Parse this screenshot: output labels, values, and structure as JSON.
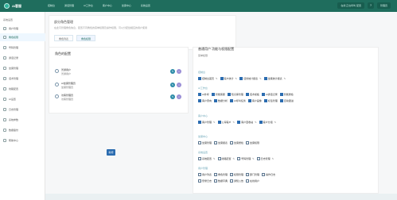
{
  "topbar": {
    "app_name": "AI客服",
    "nav": [
      "控制台",
      "通话管理",
      "AI工作台",
      "客户中心",
      "坐席中心",
      "系统设置"
    ],
    "status_pill": "在线 正在呼叫 配置",
    "help": "?",
    "user": "管理员"
  },
  "sidebar": {
    "title": "系统设置",
    "items": [
      "用户管理",
      "角色权限",
      "号码管理",
      "通话记录",
      "坐席管理",
      "话术管理",
      "线路配置",
      "AI设置",
      "日志管理",
      "系统参数",
      "数据备份",
      "帮助中心"
    ]
  },
  "header": {
    "title": "部分角色管理",
    "description": "在此可管理角色信息，配置不同角色的菜单权限及操作权限，可以分配给相应的用户使用",
    "tabs": [
      "角色列表",
      "角色权限"
    ]
  },
  "role_card": {
    "title": "角色的配置",
    "roles": [
      {
        "name": "普通用户",
        "desc": "普通用户"
      },
      {
        "name": "AI坐席管理员",
        "desc": "坐席管理员"
      },
      {
        "name": "访客管理员",
        "desc": "访客管理员"
      }
    ],
    "add_label": "新增"
  },
  "permissions": {
    "title": "普通用户 功能与权限配置",
    "subtitle": "菜单权限",
    "groups": [
      {
        "title": "控制台",
        "items": [
          {
            "t": "控制台首页",
            "c": true
          },
          {
            "t": "客户统计",
            "c": true
          },
          {
            "t": "话务统计报表",
            "c": true
          },
          {
            "t": "坐席统计报表",
            "c": true
          }
        ]
      },
      {
        "title": "AI工作台",
        "items": [
          {
            "t": "AI外呼",
            "c": true
          },
          {
            "t": "智能客服",
            "c": true
          },
          {
            "t": "知识库管理",
            "c": true
          },
          {
            "t": "话术模板",
            "c": true
          },
          {
            "t": "AI通话记录",
            "c": true
          },
          {
            "t": "智能质检",
            "c": true
          },
          {
            "t": "客户意向",
            "c": true
          },
          {
            "t": "数据分析",
            "c": true
          },
          {
            "t": "AI呼叫任务",
            "c": true
          },
          {
            "t": "客户画像",
            "c": true
          },
          {
            "t": "标签管理",
            "c": true
          },
          {
            "t": "自动跟进",
            "c": true
          }
        ]
      },
      {
        "title": "客户中心",
        "items": [
          {
            "t": "客户管理",
            "c": true
          },
          {
            "t": "公海客户",
            "c": true
          },
          {
            "t": "客户回收站",
            "c": true
          },
          {
            "t": "客户分组",
            "c": true
          }
        ]
      },
      {
        "title": "坐席中心",
        "items": [
          {
            "t": "坐席管理",
            "c": false
          },
          {
            "t": "坐席报表",
            "c": false
          },
          {
            "t": "坐席质检",
            "c": false
          },
          {
            "t": "坐席权限",
            "c": false
          }
        ]
      },
      {
        "title": "系统设置",
        "items": [
          {
            "t": "系统配置",
            "c": false
          },
          {
            "t": "线路配置",
            "c": false
          },
          {
            "t": "号码管理",
            "c": false
          },
          {
            "t": "日志管理",
            "c": false
          }
        ]
      },
      {
        "title": "用户管理",
        "items": [
          {
            "t": "用户列表",
            "c": false
          },
          {
            "t": "角色管理",
            "c": false
          },
          {
            "t": "权限管理",
            "c": false
          },
          {
            "t": "部门管理",
            "c": false
          },
          {
            "t": "操作日志",
            "c": false
          },
          {
            "t": "登录日志",
            "c": false
          },
          {
            "t": "数据字典",
            "c": false
          },
          {
            "t": "通知公告",
            "c": false
          },
          {
            "t": "在线用户",
            "c": false
          }
        ]
      }
    ]
  }
}
